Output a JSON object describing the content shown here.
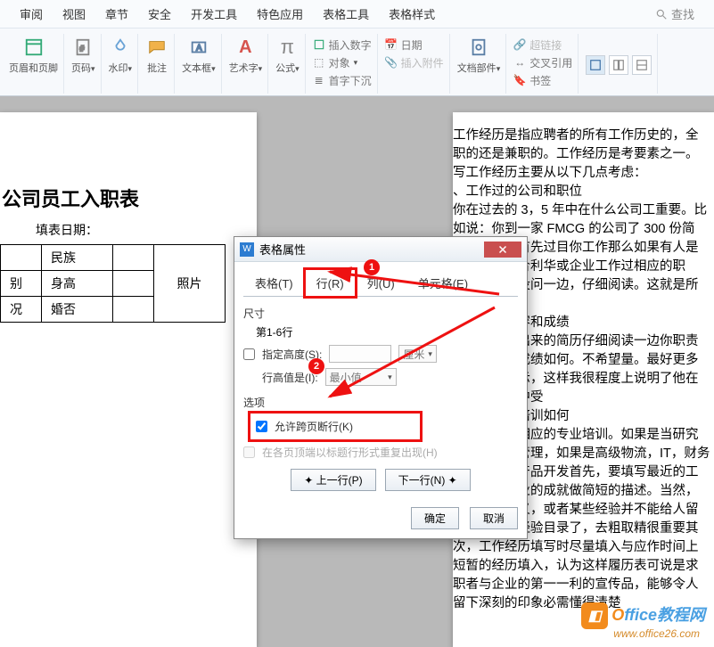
{
  "menu": {
    "review": "审阅",
    "view": "视图",
    "section": "章节",
    "security": "安全",
    "dev": "开发工具",
    "special": "特色应用",
    "table_tools": "表格工具",
    "table_style": "表格样式",
    "search": "查找"
  },
  "ribbon": {
    "header_footer": "页眉和页脚",
    "page_num": "页码",
    "watermark": "水印",
    "annotation": "批注",
    "textbox": "文本框",
    "wordart": "艺术字",
    "formula": "公式",
    "insert_num_btn": "插入数字",
    "object": "对象",
    "drop_cap": "首字下沉",
    "datetime": "日期",
    "attachment": "插入附件",
    "doc_parts": "文档部件",
    "hyperlink": "超链接",
    "cross_ref": "交叉引用",
    "bookmark": "书签",
    "wordart_label": "Α"
  },
  "doc": {
    "title": "公司员工入职表",
    "fill_date": "填表日期：",
    "cells": {
      "ethnic": "民族",
      "gender": "别",
      "height": "身高",
      "marital": "婚否",
      "status": "况",
      "photo": "照片"
    },
    "body": "工作经历是指应聘者的所有工作历史的，全职的还是兼职的。工作经历是考要素之一。\n写工作经历主要从以下几点考虑：\n、工作过的公司和职位\n你在过去的 3，5 年中在什么公司工重要。比如说：你到一家 FMCG 的公司了 300 份简历，那么他首先过目你工作那么如果有人是在宝洁、联合利华或企业工作过相应的职位，略低也没问一边，仔细阅读。这就是所谓的\n、工作的内容和成绩\n将那些挑选出来的简历仔细阅读一边你职责范围和工作成绩如何。不希望量。最好更多用数字来表示，这样我很程度上说明了他在过去的工作中受\n、你所受的培训如何\n你是否受过相应的专业培训。如果是当研究培训，销售管理，如果是高级物流，IT，财务分析，相关产品开发首先，要填写最近的工作，包括企业的成就做简短的描述。当然，如果最新的义，或者某些经验并不能给人留下最新整理经验目录了，去粗取精很重要其次，工作经历填写时尽量填入与应作时间上短暂的经历填入，认为这样履历表可说是求职者与企业的第一一利的宣传品，能够令人留下深刻的印象必需懂得清楚"
  },
  "dialog": {
    "title": "表格属性",
    "tabs": {
      "table": "表格(T)",
      "row": "行(R)",
      "column": "列(U)",
      "cell": "单元格(E)"
    },
    "size_label": "尺寸",
    "rows_label": "第1-6行",
    "spec_height": "指定高度(S):",
    "unit": "厘米",
    "row_height_is": "行高值是(I):",
    "min_value": "最小值",
    "options_label": "选项",
    "allow_break": "允许跨页断行(K)",
    "repeat_header": "在各页顶端以标题行形式重复出现(H)",
    "prev_row": "上一行(P)",
    "next_row": "下一行(N)",
    "ok": "确定",
    "cancel": "取消"
  },
  "anno": {
    "n1": "1",
    "n2": "2"
  },
  "watermark": {
    "o": "O",
    "rest": "ffice教程网",
    "sub": "www.office26.com"
  }
}
